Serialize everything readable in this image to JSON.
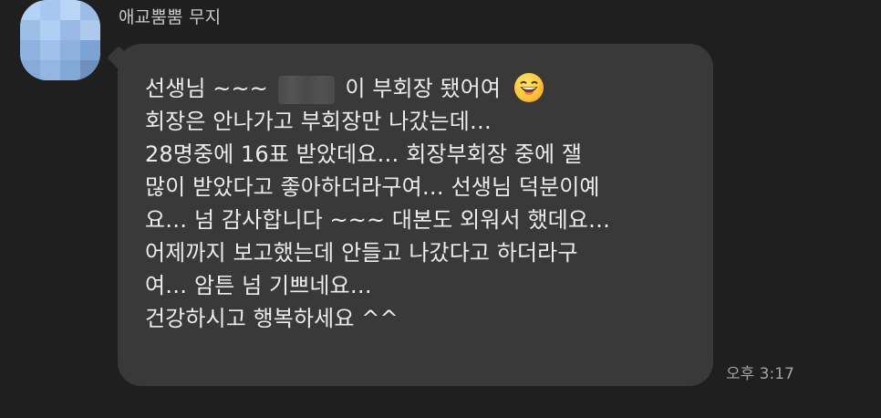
{
  "sender": {
    "name": "애교뿜뿜 무지"
  },
  "message": {
    "lines": [
      {
        "before": "선생님 ~~~",
        "after": "이 부회장 됐어여"
      },
      "회장은 안나가고 부회장만 나갔는데…",
      "28명중에 16표 받았데요… 회장부회장   중에 잴",
      "많이 받았다고 좋아하더라구여… 선생님 덕분이예",
      "요… 넘 감사합니다 ~~~ 대본도 외워서 했데요…",
      "어제까지 보고했는데 안들고 나갔다고 하더라구",
      "여… 암튼 넘 기쁘네요…",
      "건강하시고 행복하세요 ^^"
    ],
    "emoji_icon": "grinning-face-emoji-icon",
    "time": "오후 3:17"
  },
  "colors": {
    "background": "#1f1f1f",
    "bubble": "#393939",
    "message_text": "#ececec",
    "meta_text": "#a3a3a3",
    "avatar_blue": "#9bbfe9"
  }
}
